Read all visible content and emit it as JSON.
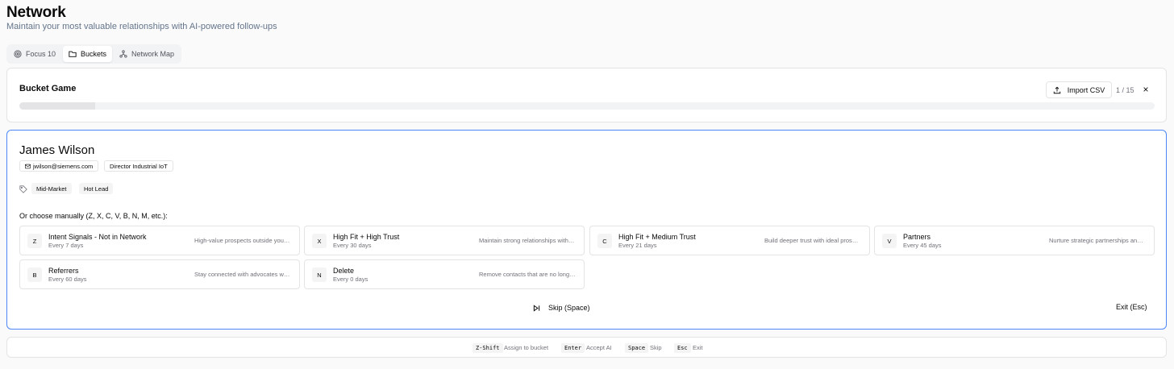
{
  "header": {
    "title": "Network",
    "subtitle": "Maintain your most valuable relationships with AI-powered follow-ups"
  },
  "tabs": [
    {
      "label": "Focus 10",
      "icon": "target-icon",
      "active": false
    },
    {
      "label": "Buckets",
      "icon": "folder-icon",
      "active": true
    },
    {
      "label": "Network Map",
      "icon": "network-icon",
      "active": false
    }
  ],
  "bucket_game": {
    "title": "Bucket Game",
    "import_label": "Import CSV",
    "counter": "1 / 15",
    "close_label": "×",
    "progress": 0.067
  },
  "contact": {
    "name": "James Wilson",
    "email": "jwilson@siemens.com",
    "role": "Director Industrial IoT",
    "tags": [
      "Mid-Market",
      "Hot Lead"
    ]
  },
  "manual_label": "Or choose manually (Z, X, C, V, B, N, M, etc.):",
  "buckets": [
    {
      "key": "Z",
      "name": "Intent Signals - Not in Network",
      "freq": "Every 7 days",
      "desc": "High-value prospects outside your network"
    },
    {
      "key": "X",
      "name": "High Fit + High Trust",
      "freq": "Every 30 days",
      "desc": "Maintain strong relationships with top contacts"
    },
    {
      "key": "C",
      "name": "High Fit + Medium Trust",
      "freq": "Every 21 days",
      "desc": "Build deeper trust with ideal prospects"
    },
    {
      "key": "V",
      "name": "Partners",
      "freq": "Every 45 days",
      "desc": "Nurture strategic partnerships and alliances"
    },
    {
      "key": "B",
      "name": "Referrers",
      "freq": "Every 60 days",
      "desc": "Stay connected with advocates who refer you"
    },
    {
      "key": "N",
      "name": "Delete",
      "freq": "Every 0 days",
      "desc": "Remove contacts that are no longer relevant"
    }
  ],
  "actions": {
    "skip": "Skip (Space)",
    "exit": "Exit (Esc)"
  },
  "shortcuts": [
    {
      "key": "Z-Shift",
      "label": "Assign to bucket"
    },
    {
      "key": "Enter",
      "label": "Accept AI"
    },
    {
      "key": "Space",
      "label": "Skip"
    },
    {
      "key": "Esc",
      "label": "Exit"
    }
  ]
}
